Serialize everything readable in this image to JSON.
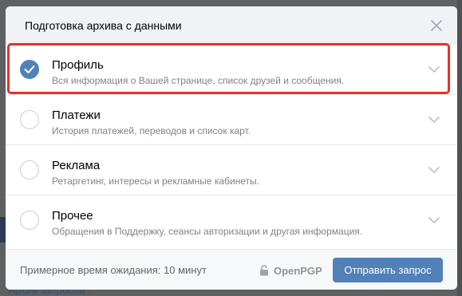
{
  "background": {
    "bottom_text": "Архив запросов ↓"
  },
  "modal": {
    "title": "Подготовка архива с данными",
    "close_icon": "close-icon",
    "options": [
      {
        "title": "Профиль",
        "description": "Вся информация о Вашей странице, список друзей и сообщения.",
        "checked": true
      },
      {
        "title": "Платежи",
        "description": "История платежей, переводов и список карт.",
        "checked": false
      },
      {
        "title": "Реклама",
        "description": "Ретаргетинг, интересы и рекламные кабинеты.",
        "checked": false
      },
      {
        "title": "Прочее",
        "description": "Обращения в Поддержку, сеансы авторизации и другая информация.",
        "checked": false
      }
    ]
  },
  "footer": {
    "wait_text": "Примерное время ожидания:  10 минут",
    "pgp_label": "OpenPGP",
    "pgp_icon": "lock-icon",
    "submit_label": "Отправить запрос"
  },
  "colors": {
    "accent": "#5181b8",
    "highlight": "#e0342a",
    "header_bg": "#f0f2f5"
  }
}
